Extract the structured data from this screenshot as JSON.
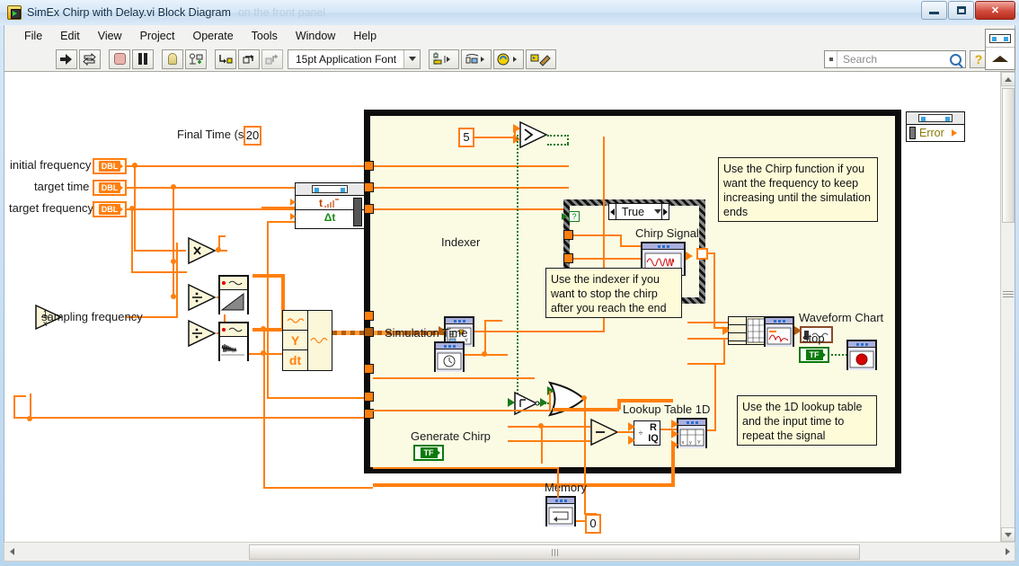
{
  "window": {
    "title": "SimEx Chirp with Delay.vi Block Diagram",
    "ghost_title": "on the front panel",
    "icon_name": "labview-vi-icon",
    "minimize": "minimize",
    "maximize": "maximize",
    "close": "close"
  },
  "menu": {
    "items": [
      "File",
      "Edit",
      "View",
      "Project",
      "Operate",
      "Tools",
      "Window",
      "Help"
    ]
  },
  "toolbar": {
    "run_label": "run-arrow",
    "run_continuous_label": "run-continuously",
    "abort_label": "abort-execution",
    "pause_label": "pause",
    "highlight_label": "highlight-execution",
    "probe_label": "retain-wire-values",
    "step_into_label": "step-into",
    "step_over_label": "step-over",
    "step_out_label": "step-out",
    "font_selector": "15pt Application Font",
    "align_label": "align-objects",
    "distribute_label": "distribute-objects",
    "reorder_label": "reorder",
    "cleanup_label": "clean-up-diagram",
    "search_placeholder": "Search",
    "help_label": "?"
  },
  "diagram": {
    "labels": {
      "final_time": "Final Time (s)",
      "initial_frequency": "initial frequency",
      "target_time": "target time",
      "target_frequency": "target frequency",
      "sampling_frequency": "sampling frequency",
      "indexer": "Indexer",
      "chirp_signal": "Chirp Signal",
      "waveform_chart": "Waveform Chart",
      "simulation_time": "Simulation Time",
      "lookup_table": "Lookup Table 1D",
      "memory": "Memory",
      "generate_chirp": "Generate Chirp",
      "stop": "stop",
      "error": "Error"
    },
    "constants": {
      "final_time_value": "20",
      "threshold": "5",
      "memory_init": "0"
    },
    "terminals": {
      "dbl": "DBL",
      "tf": "TF"
    },
    "case_structure": {
      "selected_case": "True"
    },
    "sim_params": {
      "time": "t",
      "delta_t": "Δt"
    },
    "build_waveform": {
      "y": "Y",
      "dt": "dt"
    },
    "quotient_remainder": {
      "r": "R",
      "iq": "IQ"
    },
    "comments": [
      "Use the Chirp function if you want the frequency to keep increasing until the simulation ends",
      "Use the indexer if you want to stop the chirp after you reach the end",
      "Use the 1D lookup table and the input time to repeat the signal"
    ],
    "operators": {
      "multiply": "×",
      "divide": "÷",
      "subtract": "−",
      "greater_than": ">",
      "not": "¬",
      "or": "or",
      "reciprocal": "1/x"
    }
  },
  "colors": {
    "wire_orange": "#ff7f0e",
    "wire_orange_dark": "#b25c08",
    "wire_green": "#1a7a1a",
    "loop_bg": "#fbfbe4",
    "comment_bg": "#fdfbd8",
    "sim_node_bg": "#cfd0ef"
  }
}
